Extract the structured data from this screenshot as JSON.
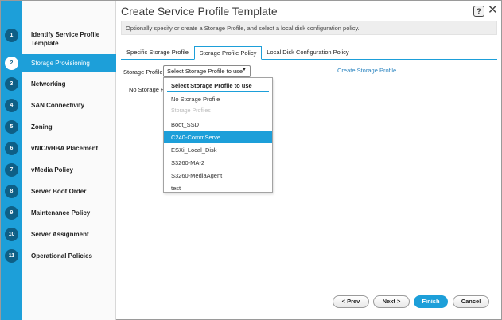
{
  "window": {
    "title": "Create Service Profile Template"
  },
  "info_text": "Optionally specify or create a Storage Profile, and select a local disk configuration policy.",
  "steps": [
    {
      "num": "1",
      "label": "Identify Service Profile Template"
    },
    {
      "num": "2",
      "label": "Storage Provisioning"
    },
    {
      "num": "3",
      "label": "Networking"
    },
    {
      "num": "4",
      "label": "SAN Connectivity"
    },
    {
      "num": "5",
      "label": "Zoning"
    },
    {
      "num": "6",
      "label": "vNIC/vHBA Placement"
    },
    {
      "num": "7",
      "label": "vMedia Policy"
    },
    {
      "num": "8",
      "label": "Server Boot Order"
    },
    {
      "num": "9",
      "label": "Maintenance Policy"
    },
    {
      "num": "10",
      "label": "Server Assignment"
    },
    {
      "num": "11",
      "label": "Operational Policies"
    }
  ],
  "active_step": "2",
  "tabs": [
    "Specific Storage Profile",
    "Storage Profile Policy",
    "Local Disk Configuration Policy"
  ],
  "form": {
    "storage_profile_label": "Storage Profile:",
    "select_value": "Select Storage Profile to use",
    "create_link": "Create Storage Profile",
    "no_storage_partial": "No Storage P"
  },
  "dropdown": {
    "header": "Select Storage Profile to use",
    "items": [
      "No Storage Profile",
      "Storage Profiles",
      "Boot_SSD",
      "C240-CommServe",
      "ESXi_Local_Disk",
      "S3260-MA-2",
      "S3260-MediaAgent",
      "test"
    ],
    "highlighted": "C240-CommServe"
  },
  "buttons": {
    "prev": "< Prev",
    "next": "Next >",
    "finish": "Finish",
    "cancel": "Cancel"
  },
  "colors": {
    "accent": "#1d9fd9",
    "step_circle": "#0e5f86"
  }
}
